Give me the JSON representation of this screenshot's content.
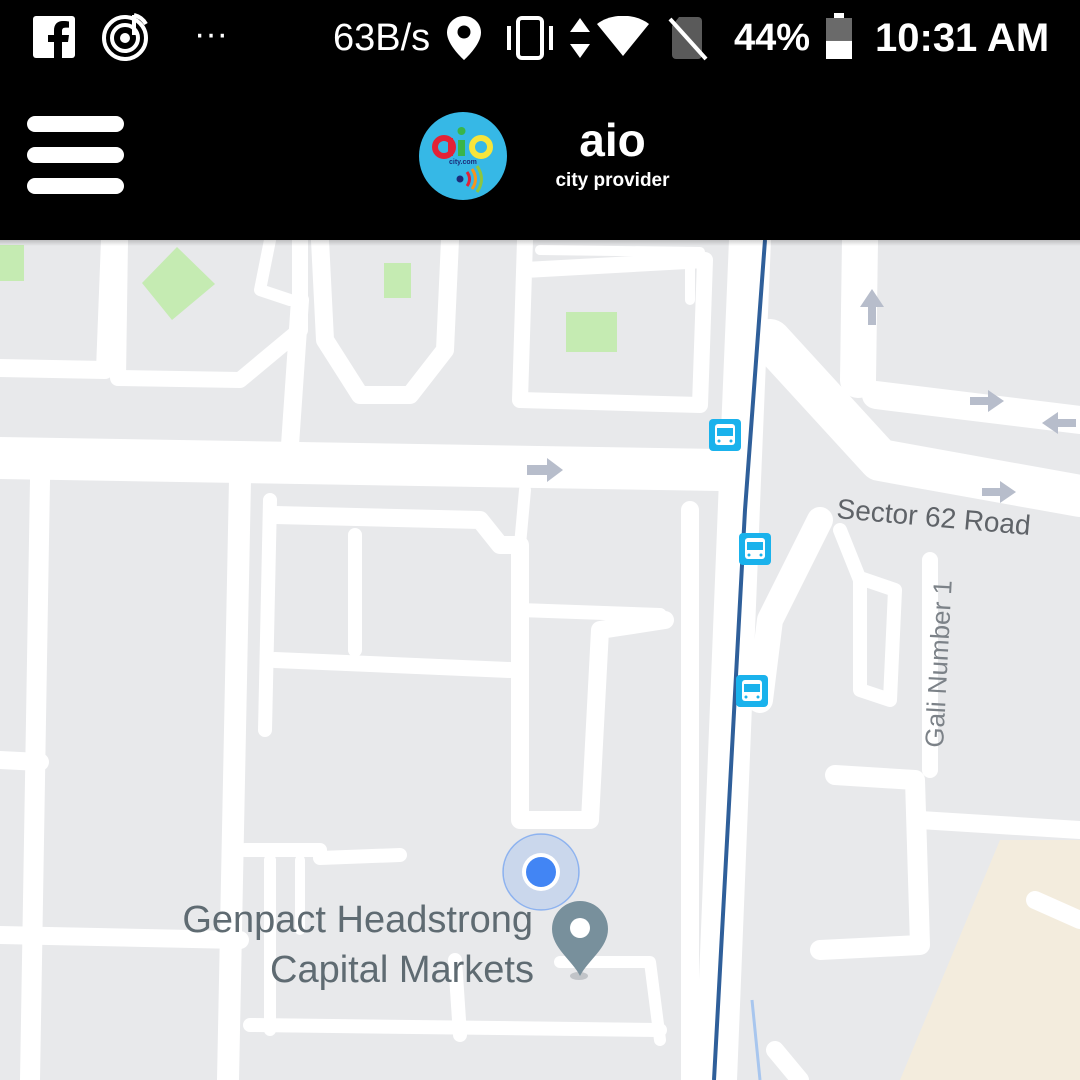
{
  "status_bar": {
    "network_speed": "63B/s",
    "battery_percent": "44%",
    "time": "10:31 AM",
    "overflow_dots": "···",
    "battery_level": 0.44,
    "icons": [
      "facebook-icon",
      "music-app-icon",
      "location-icon",
      "vibrate-icon",
      "data-transfer-icon",
      "wifi-icon",
      "no-sim-icon",
      "battery-icon"
    ]
  },
  "header": {
    "app_name": "aio",
    "app_tagline": "city provider",
    "logo_text": "aio",
    "logo_subtext": "city.com",
    "menu_icon": "hamburger-menu-icon"
  },
  "map": {
    "road_labels": {
      "sector_62_road": "Sector 62 Road",
      "gali_number_1": "Gali Number 1"
    },
    "poi": {
      "name_line1": "Genpact Headstrong",
      "name_line2": "Capital Markets",
      "icon": "place-pin-icon"
    },
    "bus_stop_icon": "bus-stop-icon",
    "one_way_arrow_icon": "one-way-arrow-icon",
    "current_location_icon": "current-location-dot",
    "colors": {
      "background": "#e8e9eb",
      "road": "#ffffff",
      "park": "#c5ebb2",
      "rail_line": "#2f5f9a",
      "bus_stop": "#1ab2ec",
      "location_dot": "#4285f4",
      "poi_pin": "#78909c",
      "poi_text": "#5f6b72",
      "sand_area": "#f3ecdd"
    }
  }
}
